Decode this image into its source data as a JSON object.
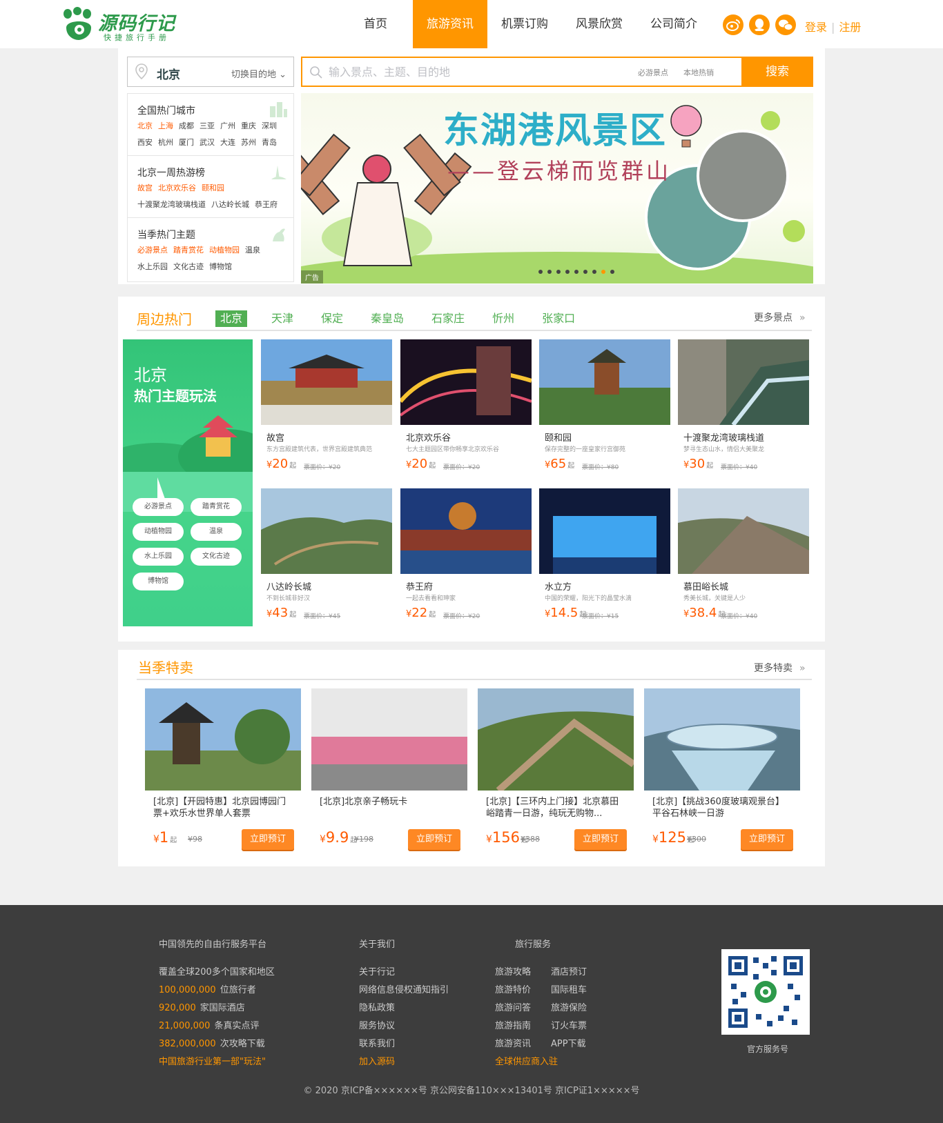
{
  "header": {
    "logo_title": "源码行记",
    "logo_subtitle": "快捷旅行手册",
    "nav": [
      "首页",
      "旅游资讯",
      "机票订购",
      "风景欣赏",
      "公司简介"
    ],
    "active_nav": "旅游资讯",
    "login": "登录",
    "register": "注册",
    "social_icons": [
      "weibo-icon",
      "qq-icon",
      "wechat-icon"
    ]
  },
  "city": {
    "current": "北京",
    "switch_label": "切换目的地"
  },
  "search": {
    "placeholder": "输入景点、主题、目的地",
    "quick_links": [
      "必游景点",
      "本地热销"
    ],
    "button": "搜索"
  },
  "side_menu": {
    "hot_cities_title": "全国热门城市",
    "hot_cities_row1": [
      "北京",
      "上海",
      "成都",
      "三亚",
      "广州",
      "重庆",
      "深圳"
    ],
    "hot_cities_row2": [
      "西安",
      "杭州",
      "厦门",
      "武汉",
      "大连",
      "苏州",
      "青岛"
    ],
    "weekly_title": "北京一周热游榜",
    "weekly_row1": [
      "故宫",
      "北京欢乐谷",
      "颐和园"
    ],
    "weekly_row2": [
      "十渡聚龙湾玻璃栈道",
      "八达岭长城",
      "恭王府"
    ],
    "theme_title": "当季热门主题",
    "theme_row1": [
      "必游景点",
      "踏青赏花",
      "动植物园",
      "温泉"
    ],
    "theme_row2": [
      "水上乐园",
      "文化古迹",
      "博物馆"
    ]
  },
  "banner": {
    "title": "东湖港风景区",
    "subtitle": "——登云梯而览群山",
    "ad_tag": "广告",
    "slide_count": 9,
    "active_slide": 7
  },
  "nearby": {
    "title": "周边热门",
    "tabs": [
      "北京",
      "天津",
      "保定",
      "秦皇岛",
      "石家庄",
      "忻州",
      "张家口"
    ],
    "active_tab": "北京",
    "more": "更多景点",
    "theme_card": {
      "city": "北京",
      "subtitle": "热门主题玩法",
      "pills": [
        "必游景点",
        "踏青赏花",
        "动植物园",
        "温泉",
        "水上乐园",
        "文化古迹",
        "博物馆"
      ]
    },
    "spots": [
      {
        "name": "故宫",
        "desc": "东方宫殿建筑代表，世界宫殿建筑典范",
        "price": "20",
        "orig": "票面价：¥20"
      },
      {
        "name": "北京欢乐谷",
        "desc": "七大主题园区带你畅享北京欢乐谷",
        "price": "20",
        "orig": "票面价：¥20"
      },
      {
        "name": "颐和园",
        "desc": "保存完整的一座皇家行宫御苑",
        "price": "65",
        "orig": "票面价：¥80"
      },
      {
        "name": "十渡聚龙湾玻璃栈道",
        "desc": "梦寻生态山水，情侣大美聚龙",
        "price": "30",
        "orig": "票面价：¥40"
      },
      {
        "name": "八达岭长城",
        "desc": "不到长城非好汉",
        "price": "43",
        "orig": "票面价：¥45"
      },
      {
        "name": "恭王府",
        "desc": "一起去看看和珅家",
        "price": "22",
        "orig": "票面价：¥20"
      },
      {
        "name": "水立方",
        "desc": "中国的荣耀，阳光下的晶莹水滴",
        "price": "14.5",
        "orig": "票面价：¥15"
      },
      {
        "name": "慕田峪长城",
        "desc": "秀美长城，关键是人少",
        "price": "38.4",
        "orig": "票面价：¥40"
      }
    ],
    "yen": "¥",
    "qi": "起"
  },
  "deals": {
    "title": "当季特卖",
    "more": "更多特卖",
    "book_label": "立即预订",
    "items": [
      {
        "title": "[北京]【开园特惠】北京园博园门票+欢乐水世界单人套票",
        "price": "1",
        "orig": "¥98"
      },
      {
        "title": "[北京]北京亲子畅玩卡",
        "price": "9.9",
        "orig": "¥198"
      },
      {
        "title": "[北京]【三环内上门接】北京慕田峪踏青一日游，纯玩无购物...",
        "price": "156",
        "orig": "¥388"
      },
      {
        "title": "[北京]【挑战360度玻璃观景台】平谷石林峡一日游",
        "price": "125",
        "orig": "¥300"
      }
    ]
  },
  "footer": {
    "col1_title": "中国领先的自由行服务平台",
    "col1_line": "覆盖全球200多个国家和地区",
    "stats": [
      {
        "num": "100,000,000",
        "label": "位旅行者"
      },
      {
        "num": "920,000",
        "label": "家国际酒店"
      },
      {
        "num": "21,000,000",
        "label": "条真实点评"
      },
      {
        "num": "382,000,000",
        "label": "次攻略下载"
      }
    ],
    "col1_highlight": "中国旅游行业第一部\"玩法\"",
    "col2_title": "关于我们",
    "col2_links": [
      "关于行记",
      "网络信息侵权通知指引",
      "隐私政策",
      "服务协议",
      "联系我们"
    ],
    "col2_highlight": "加入源码",
    "col3_title": "旅行服务",
    "col3_left": [
      "旅游攻略",
      "旅游特价",
      "旅游问答",
      "旅游指南",
      "旅游资讯"
    ],
    "col3_right": [
      "酒店预订",
      "国际租车",
      "旅游保险",
      "订火车票",
      "APP下载"
    ],
    "col3_highlight": "全球供应商入驻",
    "qr_label": "官方服务号",
    "copyright": "© 2020 京ICP备××××××号 京公网安备110×××13401号 京ICP证1×××××号"
  }
}
